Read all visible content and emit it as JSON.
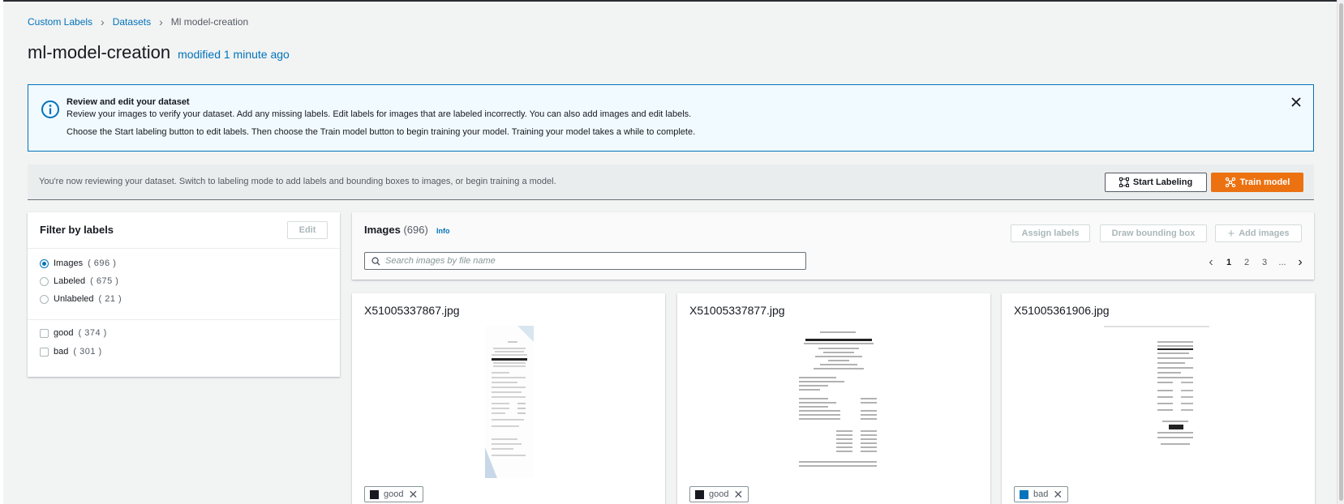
{
  "breadcrumb": {
    "items": [
      "Custom Labels",
      "Datasets"
    ],
    "current": "Ml model-creation"
  },
  "header": {
    "title": "ml-model-creation",
    "modified": "modified 1 minute ago"
  },
  "alert": {
    "title": "Review and edit your dataset",
    "line1": "Review your images to verify your dataset. Add any missing labels. Edit labels for images that are labeled incorrectly. You can also add images and edit labels.",
    "line2": "Choose the Start labeling button to edit labels. Then choose the Train model button to begin training your model. Training your model takes a while to complete."
  },
  "review_bar": {
    "text": "You're now reviewing your dataset. Switch to labeling mode to add labels and bounding boxes to images, or begin training a model.",
    "start_label": "Start Labeling",
    "train_label": "Train model"
  },
  "filter": {
    "title": "Filter by labels",
    "edit_label": "Edit",
    "radios": [
      {
        "label": "Images",
        "count": "( 696 )",
        "selected": true
      },
      {
        "label": "Labeled",
        "count": "( 675 )",
        "selected": false
      },
      {
        "label": "Unlabeled",
        "count": "( 21 )",
        "selected": false
      }
    ],
    "labels": [
      {
        "label": "good",
        "count": "( 374 )"
      },
      {
        "label": "bad",
        "count": "( 301 )"
      }
    ]
  },
  "images": {
    "title": "Images",
    "count": "(696)",
    "info": "Info",
    "assign_label": "Assign labels",
    "draw_label": "Draw bounding box",
    "add_label": "Add images",
    "search_placeholder": "Search images by file name",
    "pages": [
      "1",
      "2",
      "3",
      "..."
    ],
    "current_page": "1"
  },
  "cards": [
    {
      "file": "X51005337867.jpg",
      "tag": "good",
      "tag_color": "#16191f"
    },
    {
      "file": "X51005337877.jpg",
      "tag": "good",
      "tag_color": "#16191f"
    },
    {
      "file": "X51005361906.jpg",
      "tag": "bad",
      "tag_color": "#0073bb"
    }
  ],
  "colors": {
    "link": "#0073bb",
    "primary": "#ec7211",
    "alert_bg": "#f1faff"
  }
}
